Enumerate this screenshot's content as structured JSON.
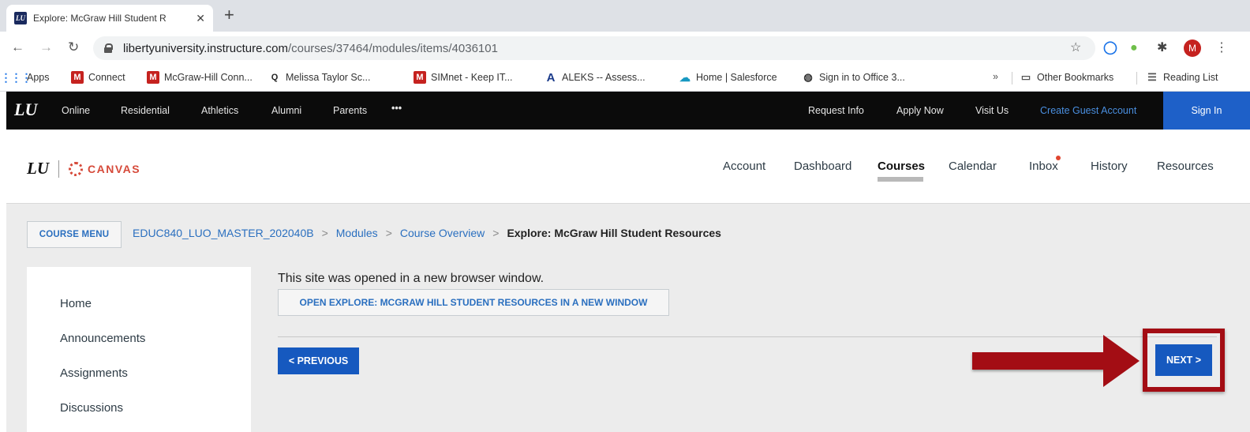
{
  "browser": {
    "tab_title": "Explore: McGraw Hill Student R",
    "tab_close": "✕",
    "new_tab": "+",
    "url_host": "libertyuniversity.instructure.com",
    "url_path": "/courses/37464/modules/items/4036101",
    "bookmarks": [
      {
        "label": "Apps",
        "icon": "apps-grid-icon"
      },
      {
        "label": "Connect",
        "icon": "m-icon"
      },
      {
        "label": "McGraw-Hill Conn...",
        "icon": "m-icon"
      },
      {
        "label": "Melissa Taylor Sc...",
        "icon": "q-icon"
      },
      {
        "label": "SIMnet - Keep IT...",
        "icon": "m-icon"
      },
      {
        "label": "ALEKS -- Assess...",
        "icon": "aleks-icon"
      },
      {
        "label": "Home | Salesforce",
        "icon": "salesforce-cloud-icon"
      },
      {
        "label": "Sign in to Office 3...",
        "icon": "globe-icon"
      },
      {
        "label": "Other Bookmarks",
        "icon": "folder-icon"
      },
      {
        "label": "Reading List",
        "icon": "reading-list-icon"
      }
    ],
    "more_bookmarks": "»",
    "avatar_letter": "M"
  },
  "lu_bar": {
    "logo": "LU",
    "left_links": [
      "Online",
      "Residential",
      "Athletics",
      "Alumni",
      "Parents",
      "•••"
    ],
    "right_links": [
      "Request Info",
      "Apply Now",
      "Visit Us",
      "Create Guest Account"
    ],
    "sign_in": "Sign In"
  },
  "canvas_header": {
    "brand_lu": "LU",
    "brand_canvas": "CANVAS",
    "nav": [
      "Account",
      "Dashboard",
      "Courses",
      "Calendar",
      "Inbox",
      "History",
      "Resources"
    ],
    "active_nav": "Courses"
  },
  "content": {
    "course_menu_label": "COURSE MENU",
    "breadcrumb": [
      "EDUC840_LUO_MASTER_202040B",
      "Modules",
      "Course Overview"
    ],
    "breadcrumb_current": "Explore: McGraw Hill Student Resources",
    "breadcrumb_sep": ">",
    "sidebar_items": [
      "Home",
      "Announcements",
      "Assignments",
      "Discussions"
    ],
    "opened_message": "This site was opened in a new browser window.",
    "open_button": "OPEN EXPLORE: MCGRAW HILL STUDENT RESOURCES IN A NEW WINDOW",
    "previous_button": "< PREVIOUS",
    "next_button": "NEXT >"
  },
  "colors": {
    "lu_bar": "#0b0b0b",
    "sign_in": "#1e60c8",
    "canvas_red": "#d64a3a",
    "link_blue": "#2a6fbf",
    "button_blue": "#1659bf",
    "annotation_red": "#a30d14"
  }
}
